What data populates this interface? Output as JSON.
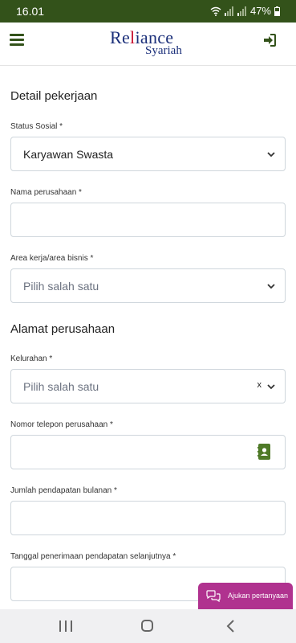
{
  "status_bar": {
    "time": "16.01",
    "battery": "47%"
  },
  "header": {
    "logo_prefix": "Re",
    "logo_accent": "l",
    "logo_suffix": "iance",
    "logo_sub": "Syariah"
  },
  "form": {
    "section_job": "Detail pekerjaan",
    "status_sosial": {
      "label": "Status Sosial *",
      "value": "Karyawan Swasta"
    },
    "nama_perusahaan": {
      "label": "Nama perusahaan *",
      "value": ""
    },
    "area_kerja": {
      "label": "Area kerja/area bisnis *",
      "placeholder": "Pilih salah satu"
    },
    "section_address": "Alamat perusahaan",
    "kelurahan": {
      "label": "Kelurahan *",
      "placeholder": "Pilih salah satu",
      "clear": "x"
    },
    "telepon": {
      "label": "Nomor telepon perusahaan *",
      "value": ""
    },
    "pendapatan": {
      "label": "Jumlah pendapatan bulanan *",
      "value": ""
    },
    "tanggal": {
      "label": "Tanggal penerimaan pendapatan selanjutnya *",
      "value": ""
    }
  },
  "chat": {
    "label": "Ajukan pertanyaan"
  },
  "icons": {
    "menu": "hamburger-icon",
    "login": "sign-in-icon",
    "chevron": "chevron-down-icon",
    "contact": "contact-book-icon",
    "chat": "chat-bubbles-icon"
  },
  "colors": {
    "brand_green": "#33521a",
    "logo_blue": "#1b2f7a",
    "logo_red": "#c8102e",
    "chat_magenta": "#b0328f",
    "contact_green": "#4f7a28"
  }
}
